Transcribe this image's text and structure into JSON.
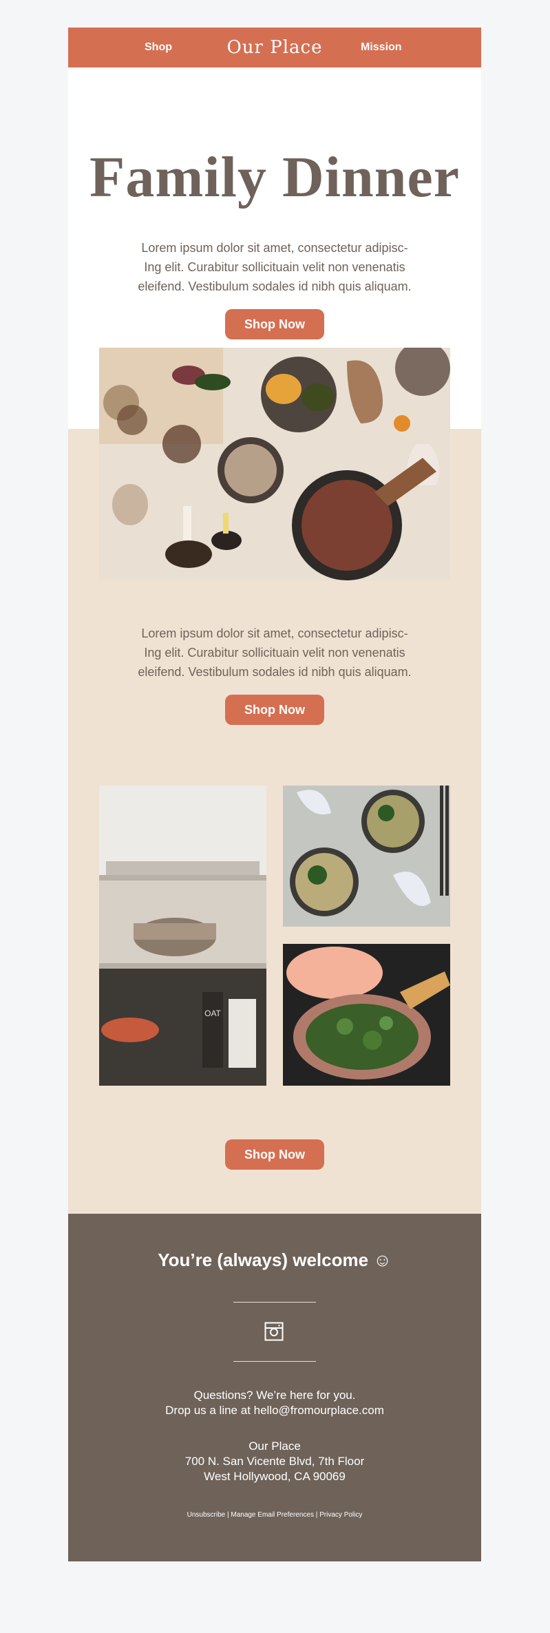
{
  "nav": {
    "shop": "Shop",
    "logo": "Our Place",
    "mission": "Mission"
  },
  "hero": {
    "title": "Family Dinner",
    "paragraph": [
      "Lorem ipsum dolor sit amet, consectetur adipisc-",
      "Ing elit. Curabitur sollicituain velit non venenatis",
      "eleifend. Vestibulum sodales id nibh quis aliquam."
    ],
    "cta": "Shop Now"
  },
  "section2": {
    "paragraph": [
      "Lorem ipsum dolor sit amet, consectetur adipisc-",
      "Ing elit. Curabitur sollicituain velit non venenatis",
      "eleifend. Vestibulum sodales id nibh quis aliquam."
    ],
    "cta": "Shop Now"
  },
  "gallery": {
    "cta": "Shop Now",
    "oat_label": "OAT"
  },
  "footer": {
    "welcome": "You’re (always) welcome ☺",
    "questions": "Questions? We’re here for you.",
    "dropline": "Drop us a line at hello@fromourplace.com",
    "company": "Our Place",
    "address1": "700 N. San Vicente Blvd, 7th Floor",
    "address2": "West Hollywood, CA 90069",
    "legal": "Unsubscribe | Manage Email Preferences | Privacy Policy"
  },
  "colors": {
    "accent": "#d56f52",
    "text": "#6e625a",
    "cream": "#f0e2d3",
    "footer_bg": "#6e6259",
    "page_bg": "#f5f6f8"
  }
}
